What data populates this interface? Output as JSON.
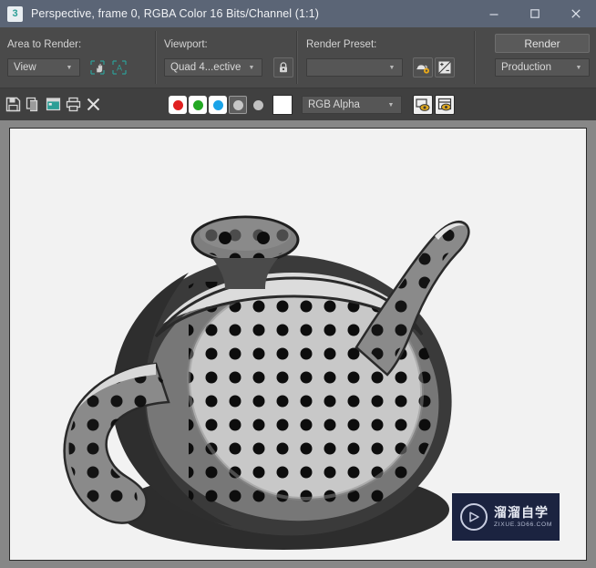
{
  "window": {
    "app_icon_label": "3",
    "title": "Perspective, frame 0, RGBA Color 16 Bits/Channel (1:1)",
    "controls": {
      "minimize": "minimize-button",
      "maximize": "maximize-button",
      "close": "close-button"
    }
  },
  "toolbar": {
    "area_to_render": {
      "label": "Area to Render:",
      "value": "View",
      "buttons": [
        "edit-region-icon",
        "auto-region-selected-icon"
      ]
    },
    "viewport": {
      "label": "Viewport:",
      "value": "Quad 4...ective",
      "lock_button": "lock-viewport-icon"
    },
    "render_preset": {
      "label": "Render Preset:",
      "value": "",
      "buttons": [
        "render-setup-icon",
        "environment-exposure-icon"
      ]
    },
    "render_button": "Render",
    "render_mode": "Production"
  },
  "toolbar2": {
    "file_tools": [
      "save-image-icon",
      "copy-image-icon",
      "clone-rendered-frame-icon",
      "print-image-icon",
      "clear-image-icon"
    ],
    "channels": [
      {
        "name": "red-channel-toggle",
        "color": "#e02020",
        "state": "on"
      },
      {
        "name": "green-channel-toggle",
        "color": "#23a823",
        "state": "on"
      },
      {
        "name": "blue-channel-toggle",
        "color": "#1aa3e8",
        "state": "on"
      },
      {
        "name": "alpha-channel-toggle",
        "color": "#c6c6c6",
        "state": "boxed"
      },
      {
        "name": "mono-channel-toggle",
        "color": "#c0c0c0",
        "state": "plain"
      }
    ],
    "background_swatch": "#ffffff",
    "channel_display": "RGB Alpha",
    "view_buttons": [
      "toggle-ui-display-icon",
      "enable-color-correction-icon"
    ]
  },
  "canvas": {
    "render": {
      "subject": "teapot",
      "material": "polka-dot-pattern",
      "background": "#f2f2f2"
    },
    "watermark": {
      "brand": "溜溜自学",
      "url": "ZIXUE.3D66.COM",
      "background": "#1b2340"
    }
  }
}
